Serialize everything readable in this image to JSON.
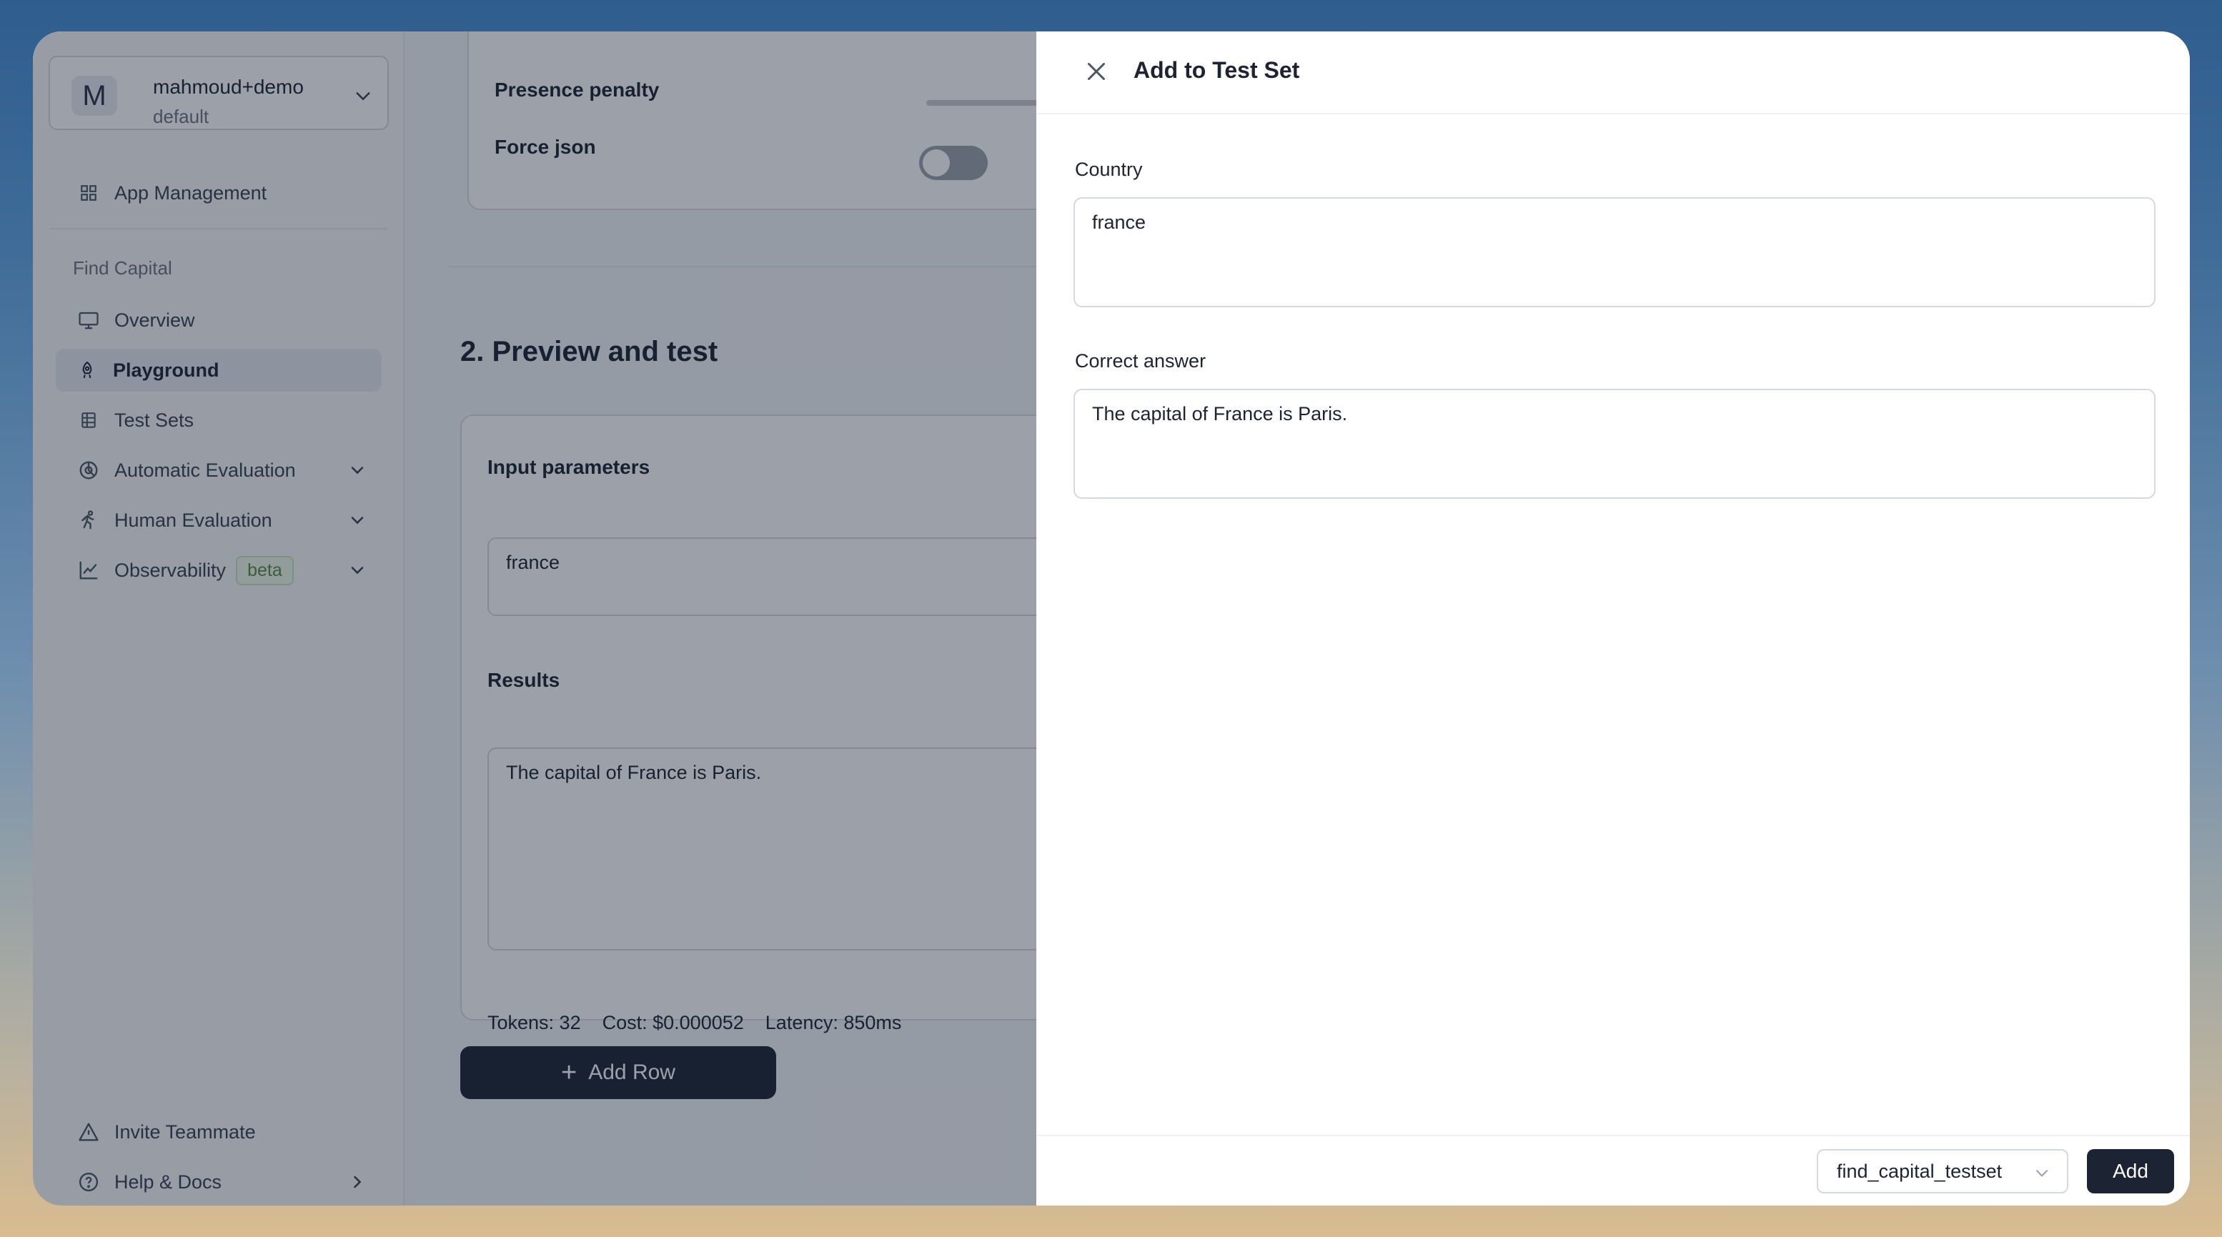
{
  "workspace": {
    "avatar_letter": "M",
    "name": "mahmoud+demo",
    "subtitle": "default"
  },
  "sidebar": {
    "app_management": "App Management",
    "section_label": "Find Capital",
    "items": [
      {
        "label": "Overview",
        "icon": "monitor-icon"
      },
      {
        "label": "Playground",
        "icon": "rocket-icon"
      },
      {
        "label": "Test Sets",
        "icon": "table-icon"
      },
      {
        "label": "Automatic Evaluation",
        "icon": "chart-pie-icon"
      },
      {
        "label": "Human Evaluation",
        "icon": "person-running-icon"
      },
      {
        "label": "Observability",
        "icon": "line-chart-icon",
        "badge": "beta"
      }
    ],
    "bottom": [
      {
        "label": "Invite Teammate",
        "icon": "warning-triangle-icon"
      },
      {
        "label": "Help & Docs",
        "icon": "question-circle-icon"
      }
    ]
  },
  "main": {
    "presence_penalty_label": "Presence penalty",
    "force_json_label": "Force json",
    "section_title": "2. Preview and test",
    "input_params_label": "Input parameters",
    "input_value": "france",
    "results_label": "Results",
    "result_text": "The capital of France is Paris.",
    "tokens": "Tokens: 32",
    "cost": "Cost: $0.000052",
    "latency": "Latency: 850ms",
    "add_row_label": "Add Row"
  },
  "drawer": {
    "title": "Add to Test Set",
    "country_label": "Country",
    "country_value": "france",
    "correct_label": "Correct answer",
    "correct_value": "The capital of France is Paris.",
    "testset_selected": "find_capital_testset",
    "add_button": "Add"
  },
  "colors": {
    "primary": "#1c2333",
    "beta_bg": "#eef7e6",
    "beta_text": "#5b8b3b"
  }
}
